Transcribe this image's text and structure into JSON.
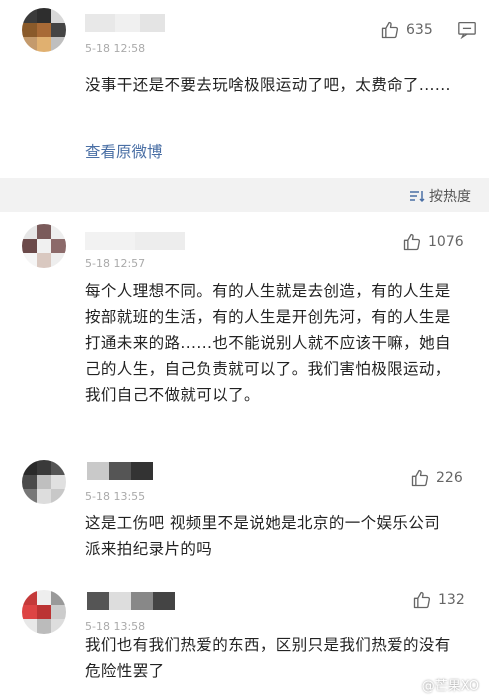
{
  "top_comment": {
    "time": "5-18 12:58",
    "like_count": "635",
    "text": "没事干还是不要去玩啥极限运动了吧，太费命了......",
    "view_original": "查看原微博"
  },
  "sort": {
    "label": "按热度"
  },
  "comments": [
    {
      "time": "5-18 12:57",
      "like_count": "1076",
      "text": "每个人理想不同。有的人生就是去创造，有的人生是按部就班的生活，有的人生是开创先河，有的人生是打通未来的路......也不能说别人就不应该干嘛，她自己的人生，自己负责就可以了。我们害怕极限运动，我们自己不做就可以了。"
    },
    {
      "time": "5-18 13:55",
      "like_count": "226",
      "text": "这是工伤吧 视频里不是说她是北京的一个娱乐公司派来拍纪录片的吗"
    },
    {
      "time": "5-18 13:58",
      "like_count": "132",
      "text": "我们也有我们热爱的东西，区别只是我们热爱的没有危险性罢了"
    }
  ],
  "watermark": "@芒果XO",
  "colors": {
    "link": "#4a6fa5",
    "background": "#f2f2f2"
  }
}
